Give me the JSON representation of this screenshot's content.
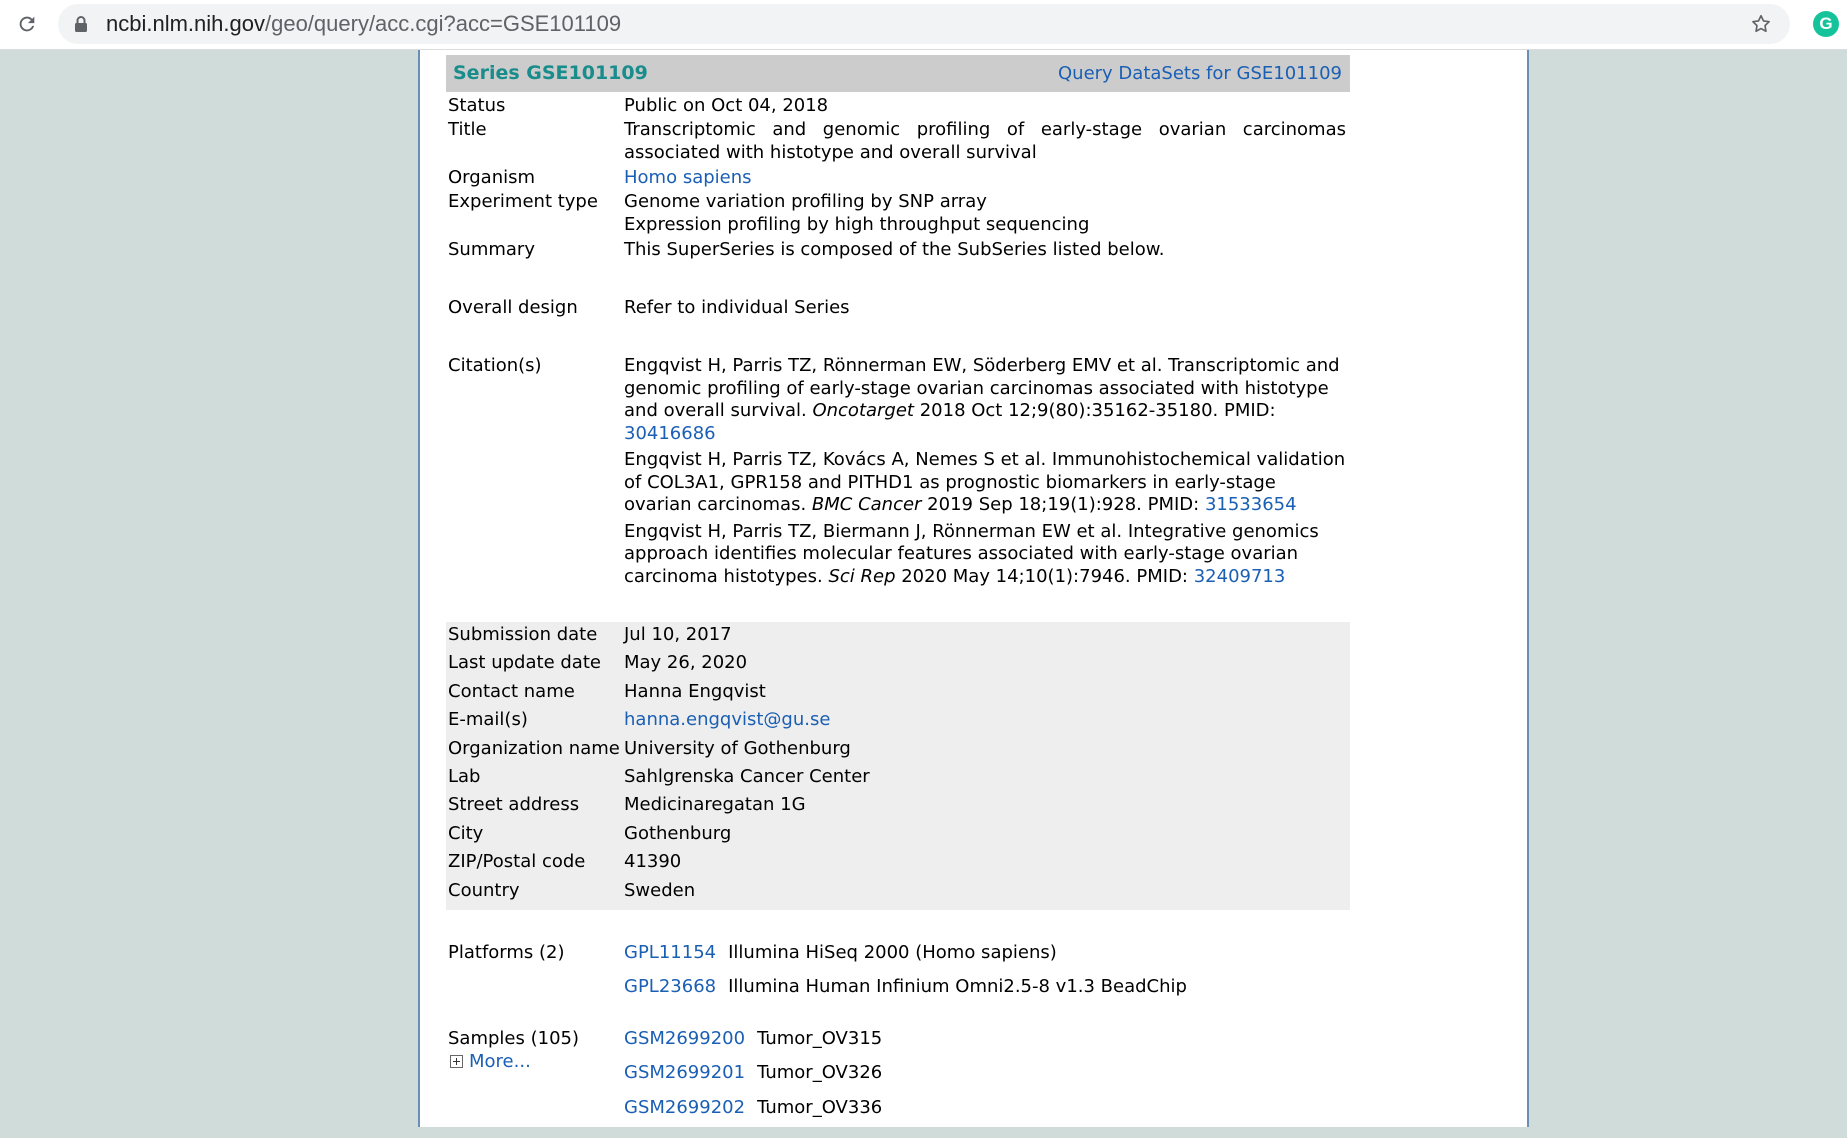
{
  "browser": {
    "url_domain": "ncbi.nlm.nih.gov",
    "url_path": "/geo/query/acc.cgi?acc=GSE101109",
    "extension_letter": "G"
  },
  "series": {
    "title": "Series GSE101109",
    "query_link": "Query DataSets for GSE101109",
    "status_label": "Status",
    "status": "Public on Oct 04, 2018",
    "title_label": "Title",
    "title_value": "Transcriptomic and genomic profiling of early-stage ovarian carcinomas associated with histotype and overall survival",
    "organism_label": "Organism",
    "organism": "Homo sapiens",
    "experiment_type_label": "Experiment type",
    "experiment_types": [
      "Genome variation profiling by SNP array",
      "Expression profiling by high throughput sequencing"
    ],
    "summary_label": "Summary",
    "summary": "This SuperSeries is composed of the SubSeries listed below.",
    "overall_design_label": "Overall design",
    "overall_design": "Refer to individual Series",
    "citations_label": "Citation(s)",
    "citations": [
      {
        "text_before": "Engqvist H, Parris TZ, Rönnerman EW, Söderberg EMV et al. Transcriptomic and genomic profiling of early-stage ovarian carcinomas associated with histotype and overall survival. ",
        "journal": "Oncotarget",
        "text_after": " 2018 Oct 12;9(80):35162-35180. PMID: ",
        "pmid": "30416686"
      },
      {
        "text_before": "Engqvist H, Parris TZ, Kovács A, Nemes S et al. Immunohistochemical validation of COL3A1, GPR158 and PITHD1 as prognostic biomarkers in early-stage ovarian carcinomas. ",
        "journal": "BMC Cancer",
        "text_after": " 2019 Sep 18;19(1):928. PMID: ",
        "pmid": "31533654"
      },
      {
        "text_before": "Engqvist H, Parris TZ, Biermann J, Rönnerman EW et al. Integrative genomics approach identifies molecular features associated with early-stage ovarian carcinoma histotypes. ",
        "journal": "Sci Rep",
        "text_after": " 2020 May 14;10(1):7946. PMID: ",
        "pmid": "32409713"
      }
    ]
  },
  "contact": {
    "submission_date_label": "Submission date",
    "submission_date": "Jul 10, 2017",
    "last_update_label": "Last update date",
    "last_update": "May 26, 2020",
    "contact_name_label": "Contact name",
    "contact_name": "Hanna Engqvist",
    "email_label": "E-mail(s)",
    "email": "hanna.engqvist@gu.se",
    "organization_label": "Organization name",
    "organization": "University of Gothenburg",
    "lab_label": "Lab",
    "lab": "Sahlgrenska Cancer Center",
    "street_label": "Street address",
    "street": "Medicinaregatan 1G",
    "city_label": "City",
    "city": "Gothenburg",
    "zip_label": "ZIP/Postal code",
    "zip": "41390",
    "country_label": "Country",
    "country": "Sweden"
  },
  "platforms": {
    "label": "Platforms (2)",
    "items": [
      {
        "id": "GPL11154",
        "name": "Illumina HiSeq 2000 (Homo sapiens)"
      },
      {
        "id": "GPL23668",
        "name": "Illumina Human Infinium Omni2.5-8 v1.3 BeadChip"
      }
    ]
  },
  "samples": {
    "label": "Samples (105)",
    "more_label": "More...",
    "items": [
      {
        "id": "GSM2699200",
        "name": "Tumor_OV315"
      },
      {
        "id": "GSM2699201",
        "name": "Tumor_OV326"
      },
      {
        "id": "GSM2699202",
        "name": "Tumor_OV336"
      }
    ]
  }
}
